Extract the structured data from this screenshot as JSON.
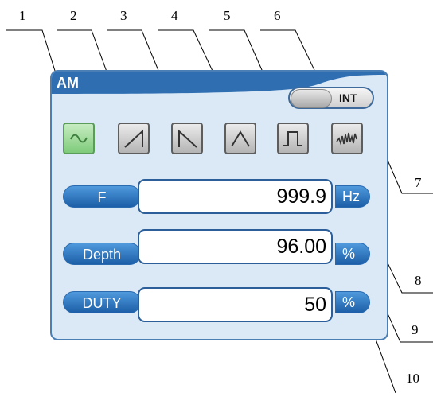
{
  "callouts": [
    "1",
    "2",
    "3",
    "4",
    "5",
    "6",
    "7",
    "8",
    "9",
    "10"
  ],
  "panel": {
    "title": "AM",
    "source_toggle": {
      "label": "INT"
    },
    "waveforms": [
      {
        "name": "sine",
        "selected": true
      },
      {
        "name": "ramp-up",
        "selected": false
      },
      {
        "name": "ramp-down",
        "selected": false
      },
      {
        "name": "triangle",
        "selected": false
      },
      {
        "name": "square",
        "selected": false
      },
      {
        "name": "noise",
        "selected": false
      }
    ],
    "fields": {
      "frequency": {
        "label": "F",
        "value": "999.9",
        "unit": "Hz"
      },
      "depth": {
        "label": "Depth",
        "value": "96.00",
        "unit": "%"
      },
      "duty": {
        "label": "DUTY",
        "value": "50",
        "unit": "%"
      }
    }
  },
  "colors": {
    "panel_bg": "#dbe9f6",
    "header_blue": "#2f6fb1",
    "selected_green": "#7ecb7a"
  }
}
